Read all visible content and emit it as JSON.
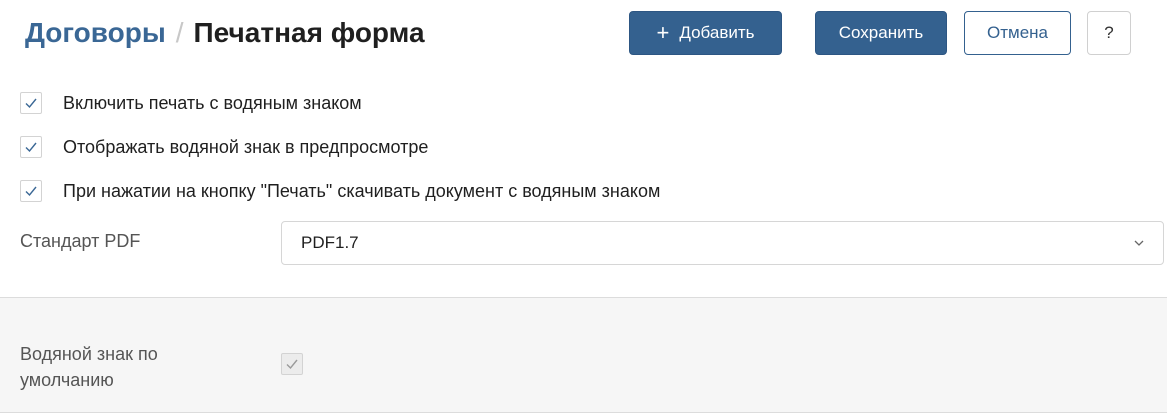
{
  "header": {
    "breadcrumb_parent": "Договоры",
    "breadcrumb_separator": "/",
    "breadcrumb_current": "Печатная форма",
    "add_icon": "plus-icon",
    "add_label": "Добавить",
    "save_label": "Сохранить",
    "cancel_label": "Отмена",
    "help_label": "?",
    "help_icon": "question-icon"
  },
  "options": [
    {
      "label": "Включить печать с водяным знаком",
      "checked": true
    },
    {
      "label": "Отображать водяной знак в предпросмотре",
      "checked": true
    },
    {
      "label": "При нажатии на кнопку \"Печать\" скачивать документ с водяным знаком",
      "checked": true
    }
  ],
  "pdf_standard": {
    "label": "Стандарт PDF",
    "value": "PDF1.7"
  },
  "default_watermark": {
    "label": "Водяной знак по умолчанию",
    "checked": true,
    "disabled": true
  },
  "colors": {
    "primary": "#34618f",
    "link": "#3a6795",
    "checkmark": "#3a6795",
    "section_bg": "#f6f6f6"
  }
}
